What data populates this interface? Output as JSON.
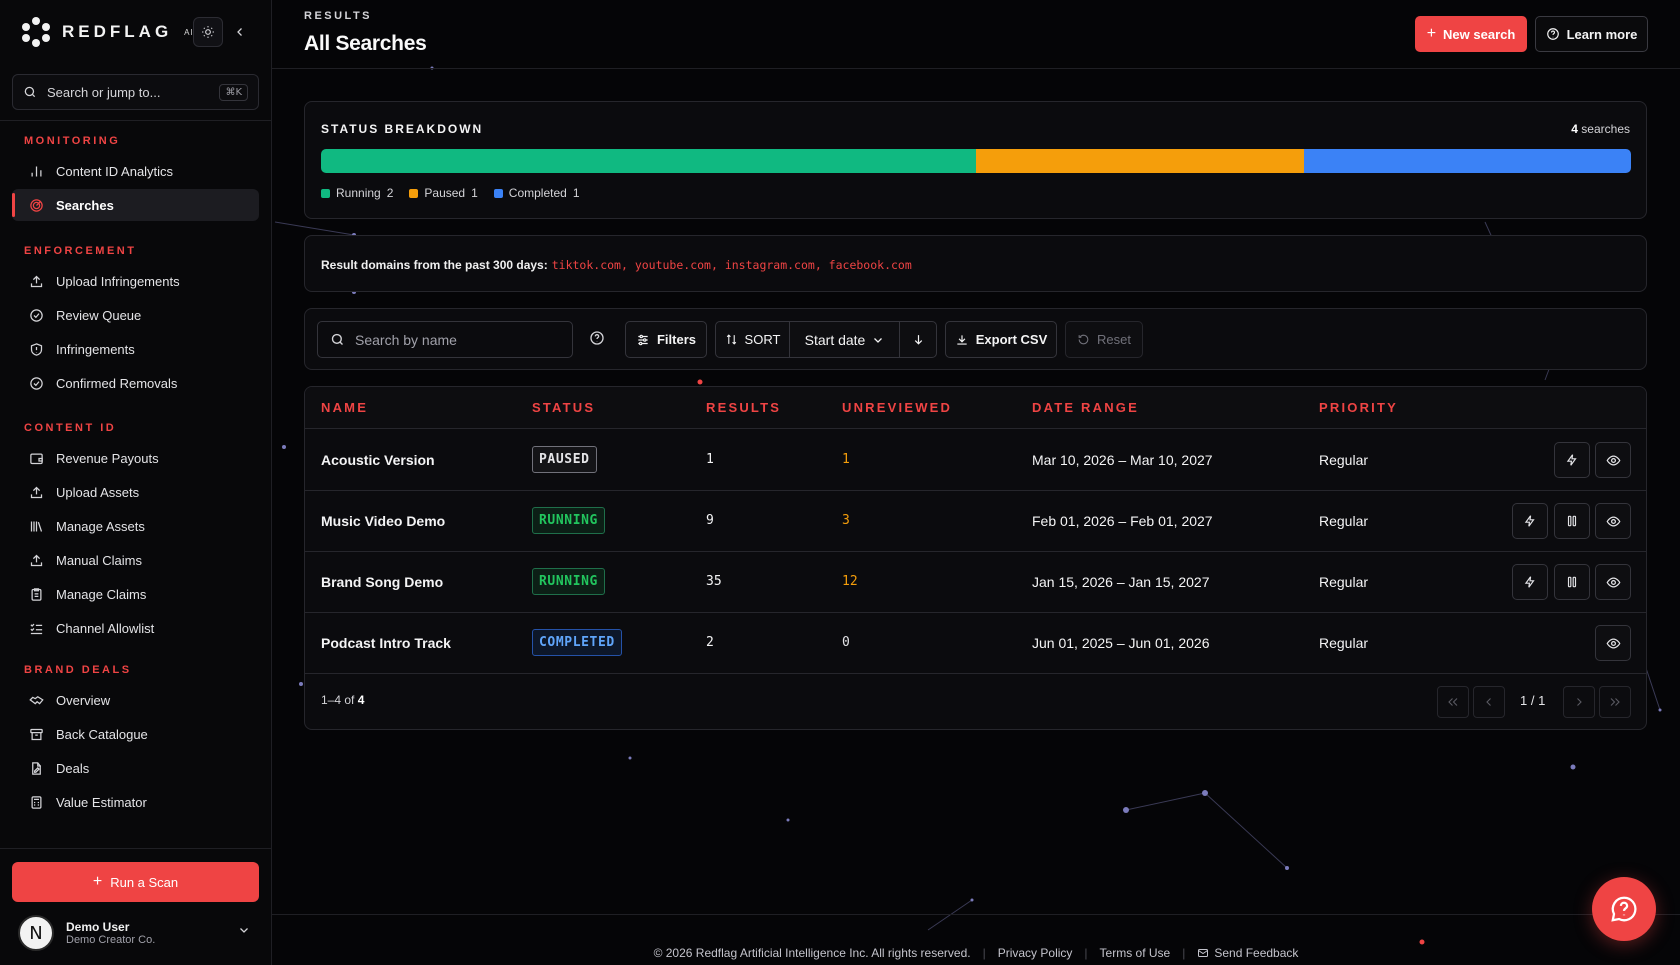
{
  "brand": {
    "name": "REDFLAG",
    "suffix": "AI"
  },
  "sidebar": {
    "search_placeholder": "Search or jump to...",
    "search_shortcut": "⌘K",
    "sections": [
      {
        "heading": "MONITORING",
        "items": [
          {
            "label": "Content ID Analytics",
            "icon": "bar-chart-icon"
          },
          {
            "label": "Searches",
            "icon": "radar-icon",
            "active": true
          }
        ]
      },
      {
        "heading": "ENFORCEMENT",
        "items": [
          {
            "label": "Upload Infringements",
            "icon": "upload-icon"
          },
          {
            "label": "Review Queue",
            "icon": "check-circle-icon"
          },
          {
            "label": "Infringements",
            "icon": "shield-icon"
          },
          {
            "label": "Confirmed Removals",
            "icon": "check-circle-icon"
          }
        ]
      },
      {
        "heading": "CONTENT ID",
        "items": [
          {
            "label": "Revenue Payouts",
            "icon": "wallet-icon"
          },
          {
            "label": "Upload Assets",
            "icon": "upload-icon"
          },
          {
            "label": "Manage Assets",
            "icon": "library-icon"
          },
          {
            "label": "Manual Claims",
            "icon": "upload-icon"
          },
          {
            "label": "Manage Claims",
            "icon": "clipboard-icon"
          },
          {
            "label": "Channel Allowlist",
            "icon": "list-check-icon"
          }
        ]
      },
      {
        "heading": "BRAND DEALS",
        "items": [
          {
            "label": "Overview",
            "icon": "handshake-icon"
          },
          {
            "label": "Back Catalogue",
            "icon": "archive-icon"
          },
          {
            "label": "Deals",
            "icon": "file-edit-icon"
          },
          {
            "label": "Value Estimator",
            "icon": "calculator-icon"
          }
        ]
      }
    ],
    "run_scan_label": "Run a Scan",
    "user": {
      "initial": "N",
      "name": "Demo User",
      "org": "Demo Creator Co."
    }
  },
  "header": {
    "eyebrow": "RESULTS",
    "title": "All Searches",
    "new_search_label": "New search",
    "learn_more_label": "Learn more"
  },
  "status": {
    "title": "STATUS BREAKDOWN",
    "total": "4",
    "total_suffix": "searches",
    "segments": [
      {
        "label": "Running",
        "count": "2",
        "color": "#10b981"
      },
      {
        "label": "Paused",
        "count": "1",
        "color": "#f59e0b"
      },
      {
        "label": "Completed",
        "count": "1",
        "color": "#3b82f6"
      }
    ]
  },
  "domains": {
    "prefix": "Result domains from the past 300 days:",
    "list": "tiktok.com, youtube.com, instagram.com, facebook.com"
  },
  "toolbar": {
    "search_placeholder": "Search by name",
    "filters_label": "Filters",
    "sort_label": "SORT",
    "sort_value": "Start date",
    "export_label": "Export CSV",
    "reset_label": "Reset"
  },
  "table": {
    "headers": [
      "NAME",
      "STATUS",
      "RESULTS",
      "UNREVIEWED",
      "DATE RANGE",
      "PRIORITY"
    ],
    "rows": [
      {
        "name": "Acoustic Version",
        "status": "PAUSED",
        "results": "1",
        "unreviewed": "1",
        "date_range": "Mar 10, 2026 – Mar 10, 2027",
        "priority": "Regular"
      },
      {
        "name": "Music Video Demo",
        "status": "RUNNING",
        "results": "9",
        "unreviewed": "3",
        "date_range": "Feb 01, 2026 – Feb 01, 2027",
        "priority": "Regular"
      },
      {
        "name": "Brand Song Demo",
        "status": "RUNNING",
        "results": "35",
        "unreviewed": "12",
        "date_range": "Jan 15, 2026 – Jan 15, 2027",
        "priority": "Regular"
      },
      {
        "name": "Podcast Intro Track",
        "status": "COMPLETED",
        "results": "2",
        "unreviewed": "0",
        "date_range": "Jun 01, 2025 – Jun 01, 2026",
        "priority": "Regular"
      }
    ],
    "range_text": "1–4 of",
    "range_total": "4",
    "page_label": "1 / 1"
  },
  "footer": {
    "copyright": "© 2026 Redflag Artificial Intelligence Inc. All rights reserved.",
    "privacy": "Privacy Policy",
    "terms": "Terms of Use",
    "feedback": "Send Feedback"
  }
}
